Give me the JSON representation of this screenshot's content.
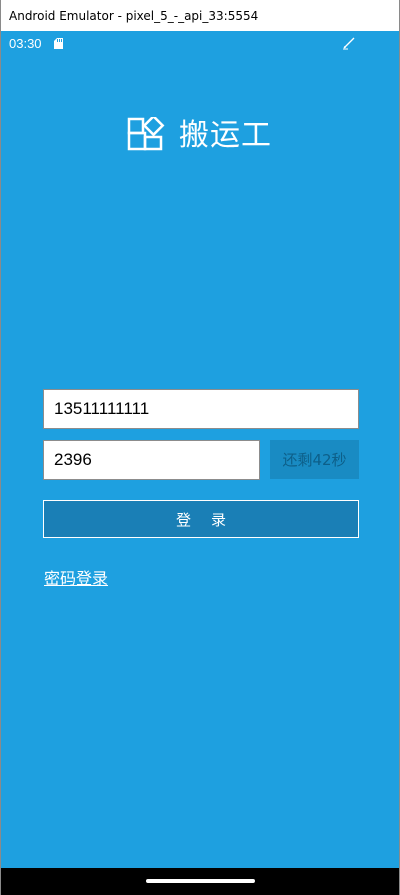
{
  "window": {
    "title": "Android Emulator - pixel_5_-_api_33:5554"
  },
  "status_bar": {
    "time": "03:30",
    "icons": [
      "sd-card-icon",
      "pen-icon"
    ]
  },
  "brand": {
    "logo_icon": "blocks-logo-icon",
    "app_name": "搬运工"
  },
  "form": {
    "phone_value": "13511111111",
    "code_value": "2396",
    "countdown_label": "还剩42秒",
    "login_label": "登录",
    "password_login_link": "密码登录"
  },
  "colors": {
    "screen_background": "#1ea0e0",
    "login_button": "#1a7fb6",
    "countdown_button": "#198bc3"
  }
}
